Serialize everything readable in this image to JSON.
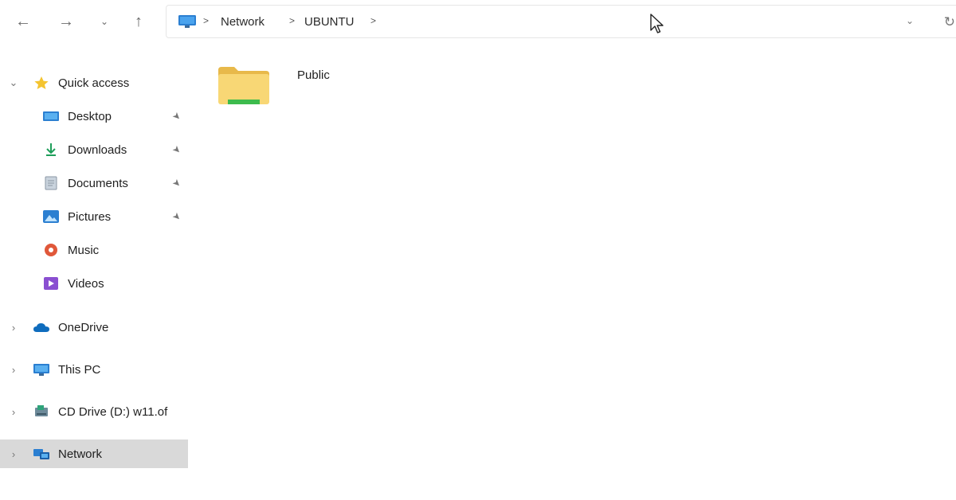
{
  "toolbar": {
    "back_icon": "arrow-left-icon",
    "forward_icon": "arrow-right-icon",
    "recent_icon": "chevron-down-icon",
    "up_icon": "arrow-up-icon"
  },
  "address_bar": {
    "breadcrumbs": [
      "Network",
      "UBUNTU"
    ],
    "separator": ">",
    "pc_icon": "monitor-icon"
  },
  "sidebar": {
    "quick_access": {
      "label": "Quick access",
      "icon": "star-icon",
      "expanded": true
    },
    "pinned": [
      {
        "label": "Desktop",
        "icon": "desktop-icon",
        "pinned": true
      },
      {
        "label": "Downloads",
        "icon": "download-icon",
        "pinned": true
      },
      {
        "label": "Documents",
        "icon": "document-icon",
        "pinned": true
      },
      {
        "label": "Pictures",
        "icon": "pictures-icon",
        "pinned": true
      },
      {
        "label": "Music",
        "icon": "music-icon",
        "pinned": false
      },
      {
        "label": "Videos",
        "icon": "video-icon",
        "pinned": false
      }
    ],
    "roots": [
      {
        "label": "OneDrive",
        "icon": "cloud-icon",
        "selected": false
      },
      {
        "label": "This PC",
        "icon": "monitor-icon",
        "selected": false
      },
      {
        "label": "CD Drive (D:) w11.of",
        "icon": "cd-drive-icon",
        "selected": false
      },
      {
        "label": "Network",
        "icon": "network-icon",
        "selected": true
      }
    ]
  },
  "content": {
    "items": [
      {
        "name": "Public",
        "icon": "folder-icon"
      }
    ]
  },
  "colors": {
    "accent": "#0078d4",
    "folder": "#f8d775",
    "selected_row": "#d9d9d9"
  }
}
